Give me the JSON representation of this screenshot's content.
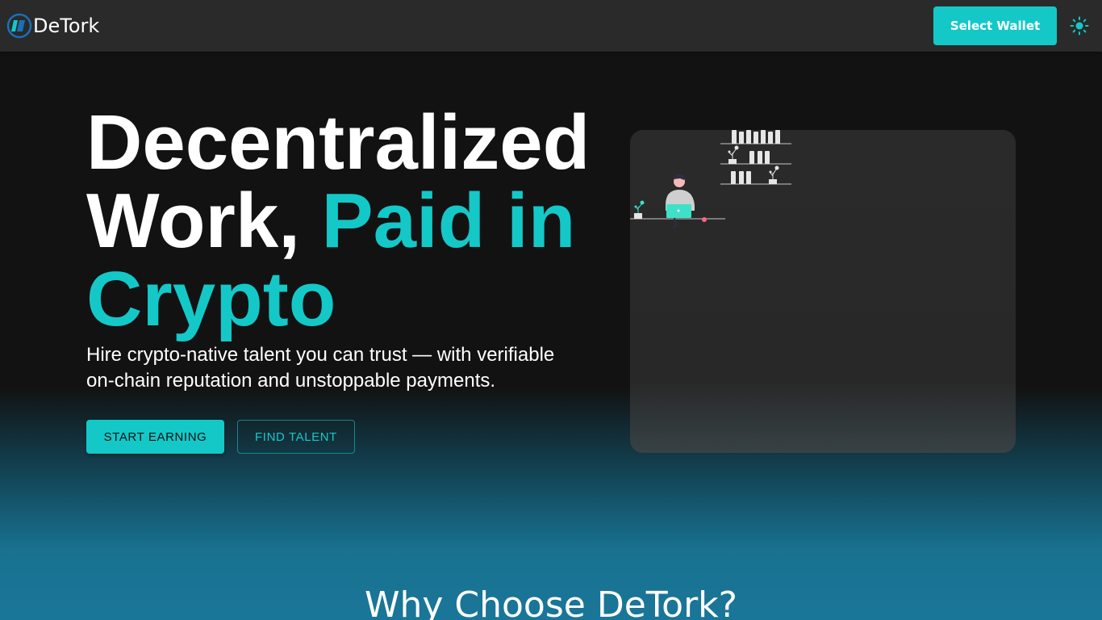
{
  "brand": {
    "name": "DeTork",
    "logo_icon": "detork-logo-icon"
  },
  "nav": {
    "wallet_button_label": "Select Wallet",
    "theme_toggle_icon": "sun-icon"
  },
  "hero": {
    "title_line1": "Decentralized",
    "title_line2_plain": "Work, ",
    "title_line2_accent": "Paid in",
    "title_line3_accent": "Crypto",
    "subtitle": "Hire crypto-native talent you can trust — with verifiable on-chain reputation and unstoppable payments.",
    "primary_cta": "START EARNING",
    "secondary_cta": "FIND TALENT",
    "illustration_icon": "remote-worker-illustration"
  },
  "section": {
    "title": "Why Choose DeTork?"
  },
  "colors": {
    "accent": "#14c8c8",
    "background": "#121212",
    "navbar": "#2a2a2a",
    "card": "#2a2a2a",
    "gradient_bottom": "#1a7699"
  }
}
